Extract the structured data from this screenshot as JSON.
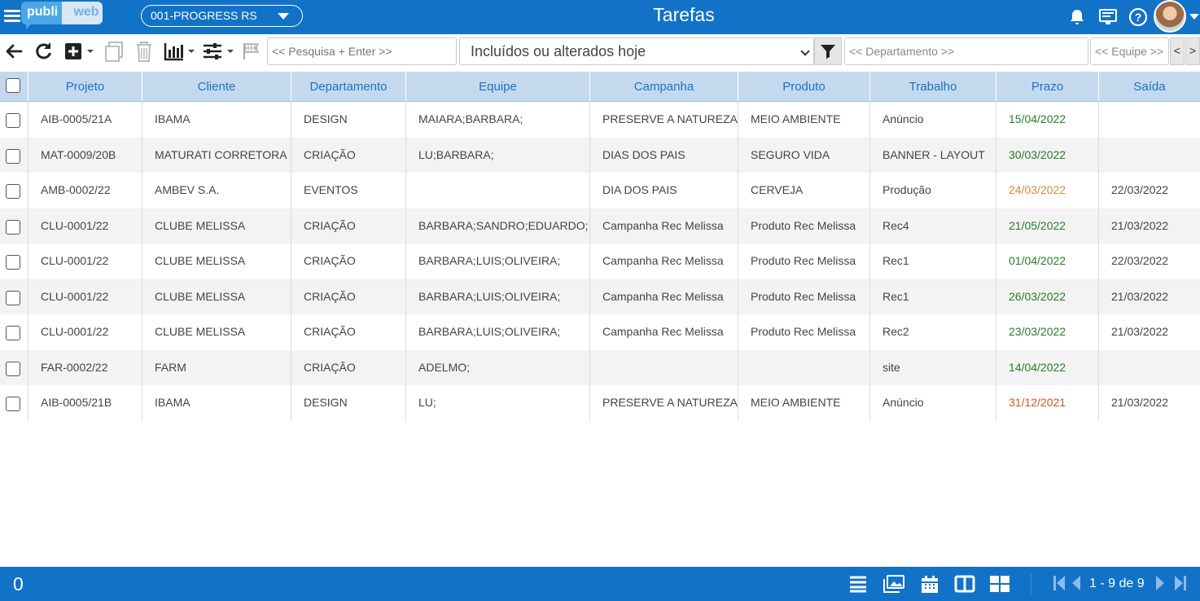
{
  "app": {
    "logo_left": "publi",
    "logo_right": "web",
    "company": "001-PROGRESS RS",
    "title": "Tarefas"
  },
  "toolbar": {
    "search_placeholder": "<< Pesquisa + Enter >>",
    "filter_value": "Incluídos ou alterados hoje",
    "department_placeholder": "<< Departamento >>",
    "team_placeholder": "<< Equipe >>",
    "prev_label": "<",
    "next_label": ">"
  },
  "table": {
    "columns": [
      "Projeto",
      "Cliente",
      "Departamento",
      "Equipe",
      "Campanha",
      "Produto",
      "Trabalho",
      "Prazo",
      "Saída"
    ],
    "rows": [
      {
        "projeto": "AIB-0005/21A",
        "cliente": "IBAMA",
        "departamento": "DESIGN",
        "equipe": "MAIARA;BARBARA;",
        "campanha": "PRESERVE A NATUREZA",
        "produto": "MEIO AMBIENTE",
        "trabalho": "Anúncio",
        "prazo": "15/04/2022",
        "prazo_status": "green",
        "saida": ""
      },
      {
        "projeto": "MAT-0009/20B",
        "cliente": "MATURATI CORRETORA",
        "departamento": "CRIAÇÃO",
        "equipe": "LU;BARBARA;",
        "campanha": "DIAS DOS PAIS",
        "produto": "SEGURO VIDA",
        "trabalho": "BANNER - LAYOUT",
        "prazo": "30/03/2022",
        "prazo_status": "green",
        "saida": ""
      },
      {
        "projeto": "AMB-0002/22",
        "cliente": "AMBEV S.A.",
        "departamento": "EVENTOS",
        "equipe": "",
        "campanha": "DIA DOS PAIS",
        "produto": "CERVEJA",
        "trabalho": "Produção",
        "prazo": "24/03/2022",
        "prazo_status": "orange",
        "saida": "22/03/2022"
      },
      {
        "projeto": "CLU-0001/22",
        "cliente": "CLUBE MELISSA",
        "departamento": "CRIAÇÃO",
        "equipe": "BARBARA;SANDRO;EDUARDO;",
        "campanha": "Campanha Rec Melissa",
        "produto": "Produto Rec Melissa",
        "trabalho": "Rec4",
        "prazo": "21/05/2022",
        "prazo_status": "green",
        "saida": "21/03/2022"
      },
      {
        "projeto": "CLU-0001/22",
        "cliente": "CLUBE MELISSA",
        "departamento": "CRIAÇÃO",
        "equipe": "BARBARA;LUIS;OLIVEIRA;",
        "campanha": "Campanha Rec Melissa",
        "produto": "Produto Rec Melissa",
        "trabalho": "Rec1",
        "prazo": "01/04/2022",
        "prazo_status": "green",
        "saida": "22/03/2022"
      },
      {
        "projeto": "CLU-0001/22",
        "cliente": "CLUBE MELISSA",
        "departamento": "CRIAÇÃO",
        "equipe": "BARBARA;LUIS;OLIVEIRA;",
        "campanha": "Campanha Rec Melissa",
        "produto": "Produto Rec Melissa",
        "trabalho": "Rec1",
        "prazo": "26/03/2022",
        "prazo_status": "green",
        "saida": "21/03/2022"
      },
      {
        "projeto": "CLU-0001/22",
        "cliente": "CLUBE MELISSA",
        "departamento": "CRIAÇÃO",
        "equipe": "BARBARA;LUIS;OLIVEIRA;",
        "campanha": "Campanha Rec Melissa",
        "produto": "Produto Rec Melissa",
        "trabalho": "Rec2",
        "prazo": "23/03/2022",
        "prazo_status": "green",
        "saida": "21/03/2022"
      },
      {
        "projeto": "FAR-0002/22",
        "cliente": "FARM",
        "departamento": "CRIAÇÃO",
        "equipe": "ADELMO;",
        "campanha": "",
        "produto": "",
        "trabalho": "site",
        "prazo": "14/04/2022",
        "prazo_status": "green",
        "saida": ""
      },
      {
        "projeto": "AIB-0005/21B",
        "cliente": "IBAMA",
        "departamento": "DESIGN",
        "equipe": "LU;",
        "campanha": "PRESERVE A NATUREZA",
        "produto": "MEIO AMBIENTE",
        "trabalho": "Anúncio",
        "prazo": "31/12/2021",
        "prazo_status": "red",
        "saida": "21/03/2022"
      }
    ]
  },
  "footer": {
    "selected_count": "0",
    "pager": "1 - 9 de 9"
  },
  "colors": {
    "brand": "#1172c8",
    "header_bg": "#c4d9ee",
    "header_text": "#1b72c6",
    "green": "#2b7a2b",
    "orange": "#d98a3a",
    "red": "#d9532b"
  },
  "icons": [
    "menu-icon",
    "bell-icon",
    "monitor-icon",
    "help-icon",
    "back-arrow-icon",
    "refresh-icon",
    "add-icon",
    "copy-icon",
    "trash-icon",
    "chart-icon",
    "sliders-icon",
    "flag-icon",
    "filter-icon",
    "list-view-icon",
    "image-view-icon",
    "calendar-view-icon",
    "columns-view-icon",
    "grid-view-icon",
    "first-page-icon",
    "prev-page-icon",
    "next-page-icon",
    "last-page-icon"
  ]
}
